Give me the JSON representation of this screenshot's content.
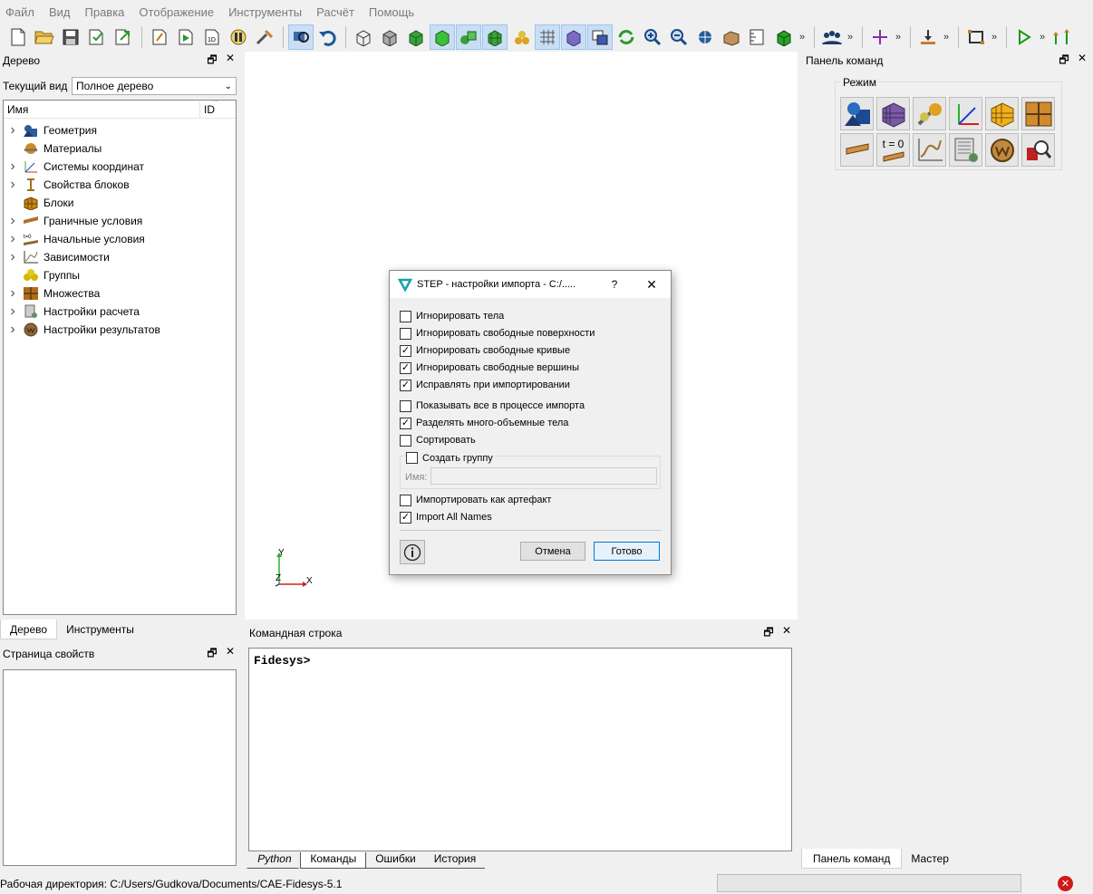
{
  "menu": [
    "Файл",
    "Вид",
    "Правка",
    "Отображение",
    "Инструменты",
    "Расчёт",
    "Помощь"
  ],
  "toolbar": {
    "icons": [
      "new-file-icon",
      "open-folder-icon",
      "save-icon",
      "save-as-icon",
      "export-icon",
      "script-icon",
      "play-script-icon",
      "journal-icon",
      "pause-icon",
      "tools-icon",
      "rotate-view-icon",
      "undo-icon",
      "wireframe-icon",
      "hidden-line-icon",
      "shaded-icon",
      "smooth-shade-icon",
      "geometry-shade-icon",
      "mesh-shade-icon",
      "reset-icon",
      "grid-icon",
      "perspective-icon",
      "clip-icon",
      "refresh-icon",
      "zoom-in-icon",
      "zoom-out-icon",
      "fit-view-icon",
      "box-view-icon",
      "ruler-icon",
      "cube-view-icon"
    ],
    "overflow": "»"
  },
  "tree_panel": {
    "title": "Дерево",
    "current_view_label": "Текущий вид",
    "current_view_value": "Полное дерево",
    "col_name": "Имя",
    "col_id": "ID",
    "items": [
      {
        "label": "Геометрия",
        "icon": "geometry-icon",
        "expandable": true,
        "color": "#2b5d9c"
      },
      {
        "label": "Материалы",
        "icon": "materials-icon",
        "expandable": false,
        "color": "#d28a1c"
      },
      {
        "label": "Системы координат",
        "icon": "axes-icon",
        "expandable": true,
        "color": "#3a8a3a"
      },
      {
        "label": "Свойства блоков",
        "icon": "block-props-icon",
        "expandable": true,
        "color": "#a07020"
      },
      {
        "label": "Блоки",
        "icon": "blocks-icon",
        "expandable": false,
        "color": "#c98a10"
      },
      {
        "label": "Граничные условия",
        "icon": "boundary-icon",
        "expandable": true,
        "color": "#b07030"
      },
      {
        "label": "Начальные условия",
        "icon": "initial-icon",
        "expandable": true,
        "color": "#8a6a30"
      },
      {
        "label": "Зависимости",
        "icon": "graph-icon",
        "expandable": true,
        "color": "#7a6a4a"
      },
      {
        "label": "Группы",
        "icon": "groups-icon",
        "expandable": false,
        "color": "#d4b800"
      },
      {
        "label": "Множества",
        "icon": "sets-icon",
        "expandable": true,
        "color": "#b06b1a"
      },
      {
        "label": "Настройки расчета",
        "icon": "calc-settings-icon",
        "expandable": true,
        "color": "#6a8a6a"
      },
      {
        "label": "Настройки результатов",
        "icon": "results-icon",
        "expandable": true,
        "color": "#8a6a3a"
      }
    ],
    "tabs": [
      "Дерево",
      "Инструменты"
    ]
  },
  "props_panel": {
    "title": "Страница свойств"
  },
  "command_panel": {
    "title": "Панель команд",
    "group_label": "Режим",
    "icons": [
      "geometry-mode-icon",
      "mesh-mode-icon",
      "materials-mode-icon",
      "axes-mode-icon",
      "blocks-mode-icon",
      "sets-mode-icon",
      "boundary-mode-icon",
      "initial-mode-icon",
      "graph-mode-icon",
      "calc-mode-icon",
      "results-mode-icon",
      "inspect-mode-icon"
    ],
    "t0_text": "t = 0",
    "tabs": [
      "Панель команд",
      "Мастер"
    ]
  },
  "console": {
    "title": "Командная строка",
    "prompt": "Fidesys>",
    "tabs": [
      "Python",
      "Команды",
      "Ошибки",
      "История"
    ]
  },
  "axes": {
    "y": "Y",
    "z": "Z",
    "x": "X"
  },
  "dialog": {
    "title": "STEP - настройки импорта - C:/.....",
    "help": "?",
    "close": "✕",
    "options": [
      {
        "label": "Игнорировать тела",
        "checked": false
      },
      {
        "label": "Игнорировать свободные поверхности",
        "checked": false
      },
      {
        "label": "Игнорировать свободные кривые",
        "checked": true
      },
      {
        "label": "Игнорировать свободные вершины",
        "checked": true
      },
      {
        "label": "Исправлять при импортировании",
        "checked": true
      },
      {
        "label": "Показывать все в процессе импорта",
        "checked": false
      },
      {
        "label": "Разделять много-объемные тела",
        "checked": true
      },
      {
        "label": "Сортировать",
        "checked": false
      }
    ],
    "create_group": {
      "label": "Создать группу",
      "checked": false
    },
    "name_label": "Имя:",
    "name_value": "",
    "options2": [
      {
        "label": "Импортировать как артефакт",
        "checked": false
      },
      {
        "label": "Import All Names",
        "checked": true
      }
    ],
    "cancel": "Отмена",
    "ok": "Готово"
  },
  "status": {
    "text": "Рабочая директория: C:/Users/Gudkova/Documents/CAE-Fidesys-5.1"
  },
  "colors": {
    "accent": "#0078d7",
    "selected_tool": "#c9def5",
    "error": "#d11a1a"
  }
}
